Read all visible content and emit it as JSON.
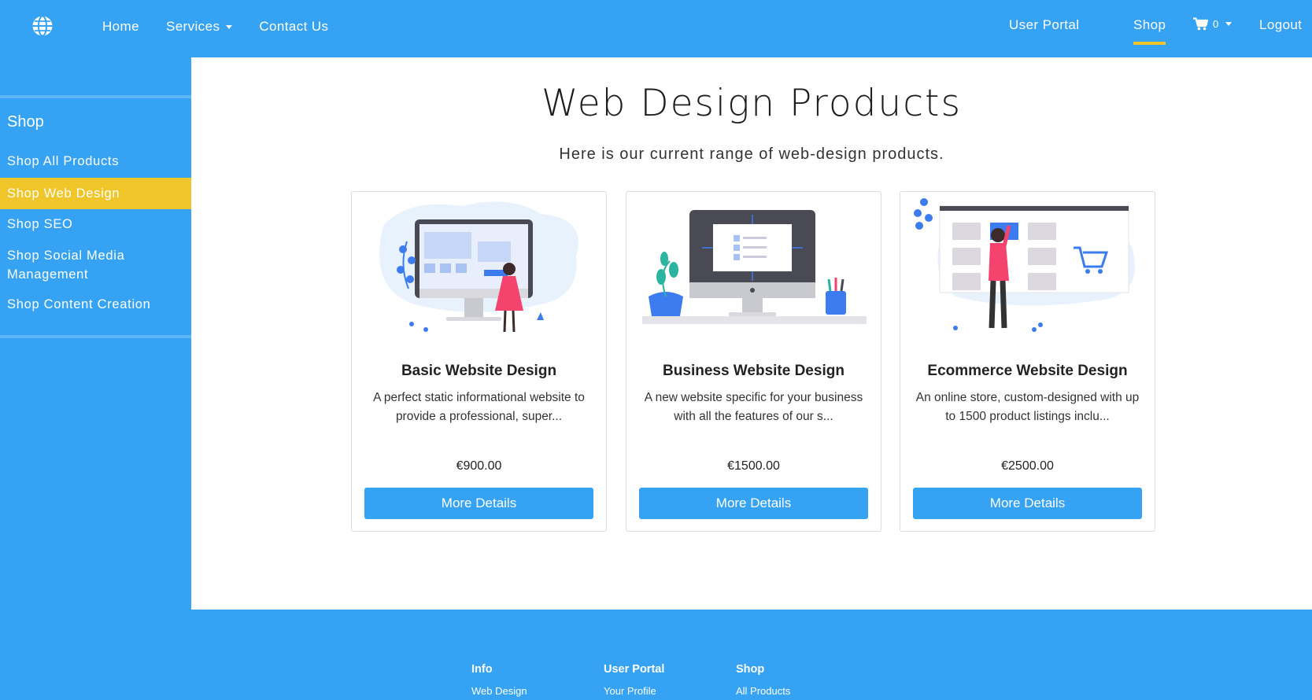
{
  "nav": {
    "logo": "globe-icon",
    "left": [
      "Home",
      "Services",
      "Contact Us"
    ],
    "user_portal": "User Portal",
    "shop": "Shop",
    "cart_count": "0",
    "logout": "Logout"
  },
  "sidebar": {
    "title": "Shop",
    "items": [
      {
        "label": "Shop All Products"
      },
      {
        "label": "Shop Web Design"
      },
      {
        "label": "Shop SEO"
      },
      {
        "label": "Shop Social Media Management"
      },
      {
        "label": "Shop Content Creation"
      }
    ]
  },
  "main": {
    "title": "Web Design Products",
    "subtitle": "Here is our current range of web-design products.",
    "products": [
      {
        "title": "Basic Website Design",
        "desc": "A perfect static informational website to provide a professional, super...",
        "price": "€900.00",
        "button": "More Details"
      },
      {
        "title": "Business Website Design",
        "desc": "A new website specific for your business with all the features of our s...",
        "price": "€1500.00",
        "button": "More Details"
      },
      {
        "title": "Ecommerce Website Design",
        "desc": "An online store, custom-designed with up to 1500 product listings inclu...",
        "price": "€2500.00",
        "button": "More Details"
      }
    ]
  },
  "footer": {
    "columns": [
      {
        "heading": "Info",
        "link": "Web Design"
      },
      {
        "heading": "User Portal",
        "link": "Your Profile"
      },
      {
        "heading": "Shop",
        "link": "All Products"
      }
    ]
  },
  "colors": {
    "primary": "#35a2f4",
    "accent": "#f1c62a",
    "illustration_pink": "#f4436c",
    "illustration_blue": "#3d7cf0"
  }
}
